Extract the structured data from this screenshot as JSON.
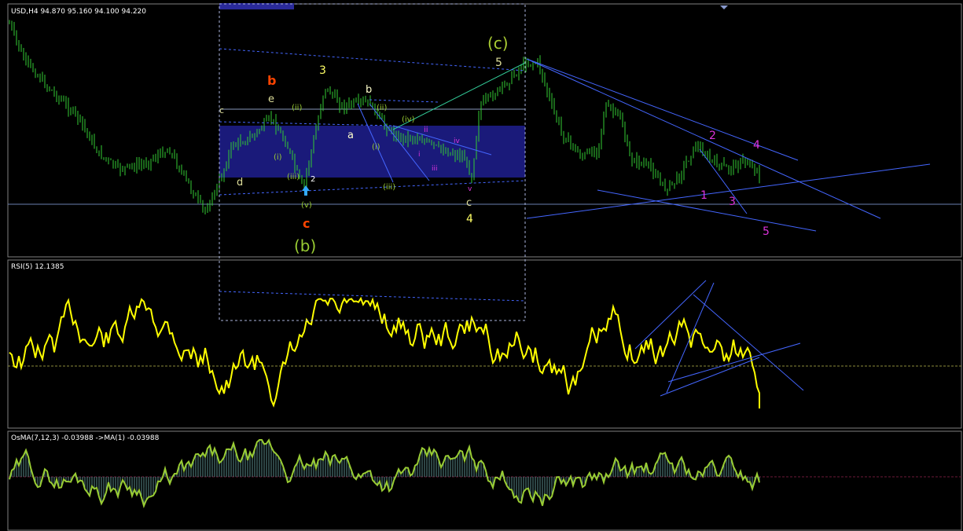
{
  "price_panel": {
    "symbol_info": "USD,H4  94.870 95.160 94.100 94.220"
  },
  "rsi_panel": {
    "label": "RSI(5) 12.1385"
  },
  "osma_panel": {
    "label": "OsMA(7,12,3) -0.03988  ->MA(1) -0.03988"
  },
  "colors": {
    "background": "#000000",
    "candles": "#33cc33",
    "rsi_line": "#ffff00",
    "osma_line": "#99cc33",
    "trendlines": "#3366ff",
    "zone": "#1a1a7a"
  },
  "chart_data": [
    {
      "type": "line",
      "panel": "price",
      "title": "USD,H4  94.870 95.160 94.100 94.220",
      "annotations": {
        "wave_labels": [
          "(c)",
          "5",
          "b",
          "3",
          "b",
          "e",
          "(ii)",
          "(ii)",
          "(iv)",
          "ii",
          "iv",
          "a",
          "(i)",
          "(i)",
          "i",
          "iii",
          "(iii)",
          "(iii)",
          "d",
          "2",
          "(v)",
          "c",
          "(b)",
          "v",
          "c",
          "4",
          "c",
          "2",
          "4",
          "1",
          "3",
          "5"
        ]
      }
    },
    {
      "type": "line",
      "panel": "indicator",
      "title": "RSI(5) 12.1385",
      "series": [
        {
          "name": "RSI(5)",
          "last_value": 12.1385
        }
      ]
    },
    {
      "type": "bar",
      "panel": "indicator",
      "title": "OsMA(7,12,3) -0.03988  ->MA(1) -0.03988",
      "series": [
        {
          "name": "OsMA(7,12,3)",
          "last_value": -0.03988
        },
        {
          "name": "MA(1)",
          "last_value": -0.03988
        }
      ]
    }
  ]
}
